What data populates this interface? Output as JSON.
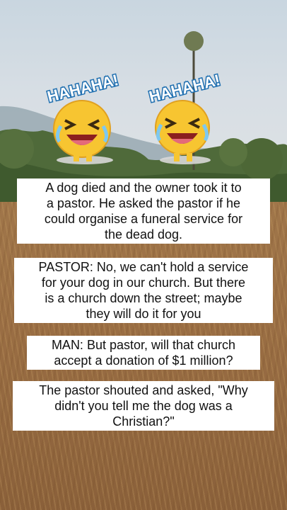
{
  "stickers": [
    {
      "text": "HAHAHA!",
      "icon": "laughing-crying-emoji-icon"
    },
    {
      "text": "HAHAHA!",
      "icon": "laughing-crying-emoji-icon"
    }
  ],
  "captions": [
    {
      "lines": [
        "A dog died and the owner took it to",
        "a pastor. He asked the pastor if he",
        "could organise a funeral service for",
        "the dead dog."
      ]
    },
    {
      "lines": [
        "PASTOR: No, we can't hold a service",
        "for your dog in our church. But there",
        "is a church down the street; maybe",
        "they will do it for you"
      ]
    },
    {
      "lines": [
        "MAN: But pastor, will that church",
        "accept a donation of $1 million?"
      ]
    },
    {
      "lines": [
        "The pastor shouted and asked, \"Why",
        "didn't you tell me the dog was a",
        "Christian?\""
      ]
    }
  ],
  "colors": {
    "bubble": "#ffffff",
    "text": "#111111",
    "emoji_face": "#f7c531",
    "sticker_letters": "#ffffff",
    "sticker_outline": "#1f6fb0"
  }
}
